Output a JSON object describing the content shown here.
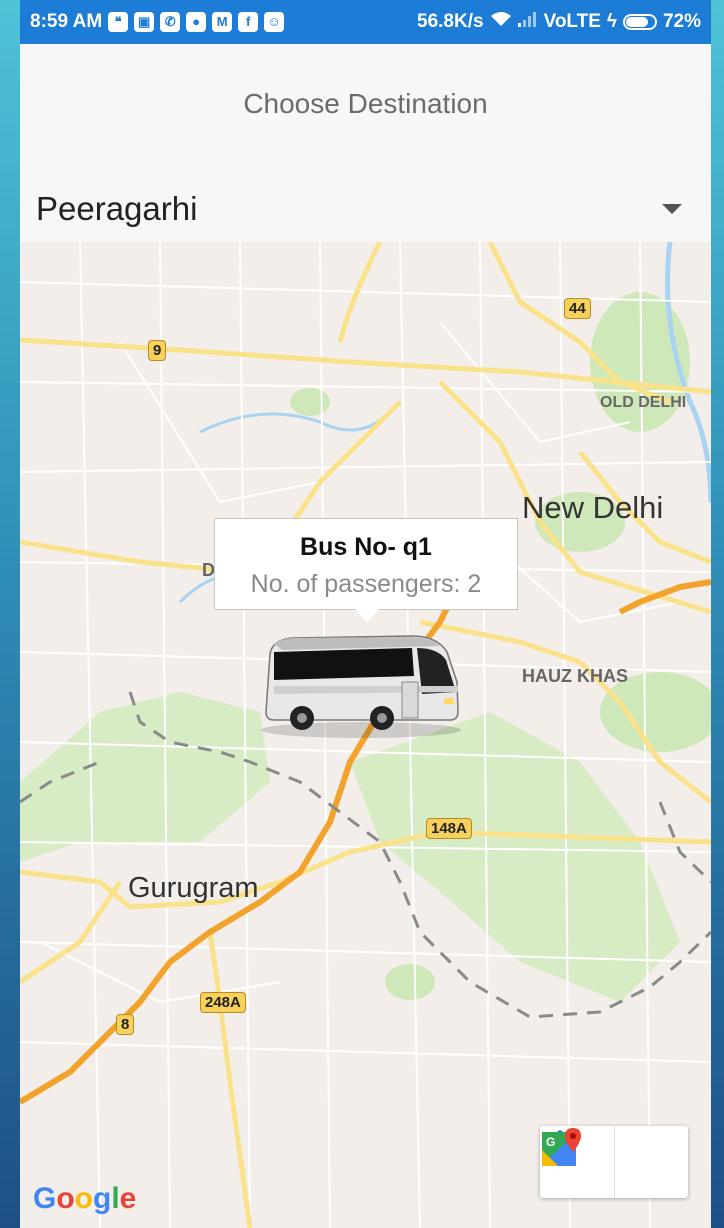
{
  "status_bar": {
    "time": "8:59 AM",
    "speed": "56.8K/s",
    "network": "VoLTE",
    "battery": "72%"
  },
  "header": {
    "title": "Choose Destination",
    "selected_destination": "Peeragarhi"
  },
  "map": {
    "labels": {
      "new_delhi": "New Delhi",
      "gurugram": "Gurugram",
      "old_delhi": "OLD DELHI",
      "hauz_khas": "HAUZ KHAS",
      "partial_d": "D"
    },
    "road_shields": [
      "9",
      "44",
      "148A",
      "248A",
      "8"
    ],
    "attribution": "Google"
  },
  "bus_marker": {
    "title": "Bus No- q1",
    "passengers": "No. of passengers: 2"
  },
  "icons": {
    "directions": "directions-icon",
    "google_maps": "google-maps-icon"
  },
  "colors": {
    "status_bar": "#1c7cd6",
    "highway": "#f2a32c",
    "road": "#f9e28a",
    "park": "#cfe8b9",
    "water": "#a9d3f0"
  }
}
